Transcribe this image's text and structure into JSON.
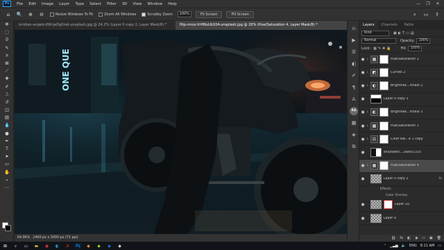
{
  "app": {
    "logo": "Ps"
  },
  "menu": [
    "File",
    "Edit",
    "Image",
    "Layer",
    "Type",
    "Select",
    "Filter",
    "3D",
    "View",
    "Window",
    "Help"
  ],
  "window_controls": [
    "—",
    "❐",
    "✕"
  ],
  "options_bar": {
    "check1": "Resize Windows To Fit",
    "check2": "Zoom All Windows",
    "check3": "Scrubby Zoom",
    "zoom_value": "100%",
    "btn_fit": "Fit Screen",
    "btn_fill": "Fill Screen"
  },
  "tabs": [
    {
      "label": "kristian-angelo-KW-jwDg0net-unsplash.jpg @ 24.2% (Layer 0 copy 2, Layer Mask/8) *"
    },
    {
      "label": "filip-mroz-VrHNuUb104-unsplash.jpg @ 20% (Hue/Saturation 4, Layer Mask/8) *"
    }
  ],
  "canvas": {
    "sign_text": "ONE QUE"
  },
  "status": {
    "zoom": "64.96%",
    "doc": "2400 px x 3000 px (72 ppi)"
  },
  "panel": {
    "tabs": [
      "Layers",
      "Channels",
      "Paths"
    ],
    "filter": "Kind",
    "blend": "Normal",
    "opacity_label": "Opacity:",
    "opacity": "100%",
    "lock_label": "Lock:",
    "fill_label": "Fill:",
    "fill": "100%"
  },
  "layers": [
    {
      "name": "Hue/Saturation 2",
      "icon": "▦",
      "type": "adj"
    },
    {
      "name": "Curves 2",
      "icon": "◩",
      "type": "adj"
    },
    {
      "name": "Brightnes...ntrast 2",
      "icon": "◐",
      "type": "adj"
    },
    {
      "name": "Layer 0 copy 3",
      "icon": "",
      "type": "pix"
    },
    {
      "name": "Brightnes...ntrast 3",
      "icon": "◐",
      "type": "adj"
    },
    {
      "name": "Hue/Saturation 3",
      "icon": "▦",
      "type": "adj"
    },
    {
      "name": "Color Bal...e 1 copy",
      "icon": "⚖",
      "type": "adj"
    },
    {
      "name": "shudlarec...168f01335",
      "icon": "",
      "type": "pix"
    },
    {
      "name": "Hue/Saturation 4",
      "icon": "▦",
      "type": "adj"
    },
    {
      "name": "Layer 0 copy 2",
      "icon": "",
      "type": "pix",
      "fx": "fx"
    }
  ],
  "effects": {
    "label": "Effects",
    "item": "Color Overlay"
  },
  "layers_bottom": [
    {
      "name": "Layer 10",
      "type": "pix"
    },
    {
      "name": "Layer 9",
      "type": "pix"
    }
  ],
  "panel_footer": [
    "⛓",
    "fx",
    "◧",
    "◑",
    "▭",
    "▣",
    "🗑"
  ],
  "tray": {
    "lang": "ENG",
    "time": "8:11 AM"
  }
}
